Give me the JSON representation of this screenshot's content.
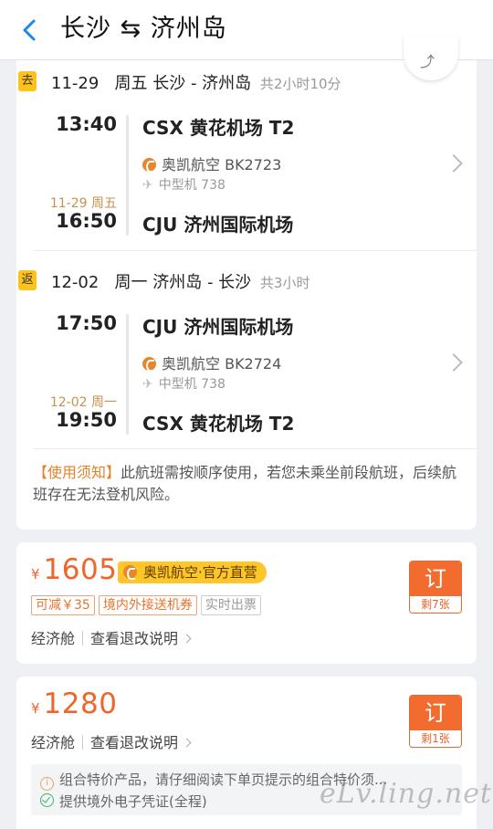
{
  "header": {
    "title": "长沙 ⇆ 济州岛"
  },
  "segments": [
    {
      "tag": "去",
      "date": "11-29",
      "weekday": "周五",
      "route": "长沙 - 济州岛",
      "duration": "共2小时10分",
      "dep_time": "13:40",
      "dep_airport": "CSX 黄花机场 T2",
      "airline": "奥凯航空 BK2723",
      "aircraft": "中型机 738",
      "arr_date": "11-29 周五",
      "arr_time": "16:50",
      "arr_airport": "CJU 济州国际机场"
    },
    {
      "tag": "返",
      "date": "12-02",
      "weekday": "周一",
      "route": "济州岛 - 长沙",
      "duration": "共3小时",
      "dep_time": "17:50",
      "dep_airport": "CJU 济州国际机场",
      "airline": "奥凯航空 BK2724",
      "aircraft": "中型机 738",
      "arr_date": "12-02 周一",
      "arr_time": "19:50",
      "arr_airport": "CSX 黄花机场 T2"
    }
  ],
  "notice": {
    "highlight": "【使用须知】",
    "text": "此航班需按顺序使用，若您未乘坐前段航班，后续航班存在无法登机风险。"
  },
  "offers": [
    {
      "currency": "¥",
      "price": "1605",
      "badge": "奥凯航空·官方直营",
      "tags": [
        "可减￥35",
        "境内外接送机券",
        "实时出票"
      ],
      "cabin": "经济舱",
      "rules": "查看退改说明",
      "book_label": "订",
      "remaining": "剩7张"
    },
    {
      "currency": "¥",
      "price": "1280",
      "cabin": "经济舱",
      "rules": "查看退改说明",
      "book_label": "订",
      "remaining": "剩1张",
      "info": [
        "组合特价产品，请仔细阅读下单页提示的组合特价须...",
        "提供境外电子凭证(全程)"
      ]
    }
  ],
  "watermark": "eLv.ling.net"
}
